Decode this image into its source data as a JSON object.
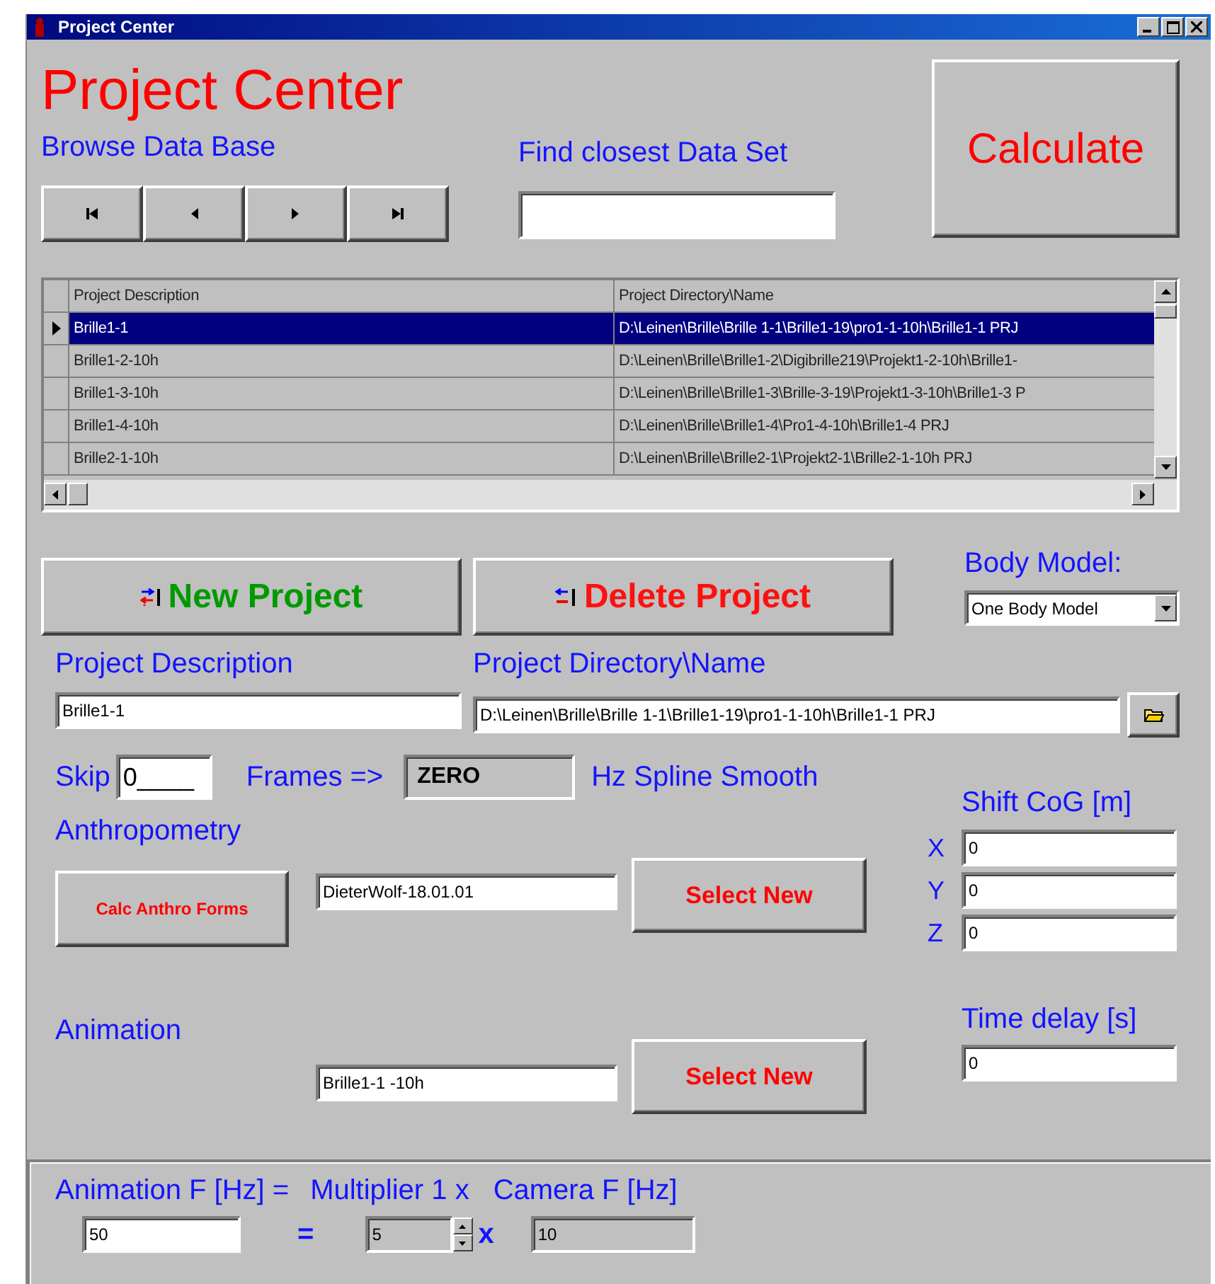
{
  "window": {
    "title": "Project Center"
  },
  "heading": "Project Center",
  "browse": {
    "label": "Browse Data Base",
    "buttons": [
      {
        "kind": "first"
      },
      {
        "kind": "prev"
      },
      {
        "kind": "next"
      },
      {
        "kind": "last"
      }
    ]
  },
  "find": {
    "label": "Find closest Data Set"
  },
  "calculate_button": "Calculate",
  "table": {
    "columns": [
      "Project Description",
      "Project Directory\\Name"
    ],
    "rows": [
      {
        "cells": [
          "Brille1-1",
          "D:\\Leinen\\Brille\\Brille 1-1\\Brille1-19\\pro1-1-10h\\Brille1-1 PRJ"
        ],
        "selected": true
      },
      {
        "cells": [
          "Brille1-2-10h",
          "D:\\Leinen\\Brille\\Brille1-2\\Digibrille219\\Projekt1-2-10h\\Brille1-"
        ],
        "selected": false
      },
      {
        "cells": [
          "Brille1-3-10h",
          "D:\\Leinen\\Brille\\Brille1-3\\Brille-3-19\\Projekt1-3-10h\\Brille1-3 P"
        ],
        "selected": false
      },
      {
        "cells": [
          "Brille1-4-10h",
          "D:\\Leinen\\Brille\\Brille1-4\\Pro1-4-10h\\Brille1-4 PRJ"
        ],
        "selected": false
      },
      {
        "cells": [
          "Brille2-1-10h",
          "D:\\Leinen\\Brille\\Brille2-1\\Projekt2-1\\Brille2-1-10h PRJ"
        ],
        "selected": false
      }
    ]
  },
  "actions": [
    {
      "kind": "new",
      "label": "New Project"
    },
    {
      "kind": "delete",
      "label": "Delete Project"
    }
  ],
  "body_model": {
    "label": "Body Model:",
    "value": "One Body Model"
  },
  "project_description": {
    "label": "Project Description",
    "value": "Brille1-1"
  },
  "project_directory": {
    "label": "Project Directory\\Name",
    "value": "D:\\Leinen\\Brille\\Brille 1-1\\Brille1-19\\pro1-1-10h\\Brille1-1 PRJ"
  },
  "skip": {
    "label": "Skip",
    "value": "0____",
    "frames_label": "Frames =>",
    "smoothing": "ZERO",
    "smoothing_label": "Hz Spline Smooth"
  },
  "anthropometry": {
    "label": "Anthropometry",
    "calc_button": "Calc Anthro Forms",
    "value": "DieterWolf-18.01.01",
    "select_button": "Select New"
  },
  "shift_cog": {
    "label": "Shift CoG [m]",
    "axes": [
      {
        "axis": "X",
        "value": "0"
      },
      {
        "axis": "Y",
        "value": "0"
      },
      {
        "axis": "Z",
        "value": "0"
      }
    ]
  },
  "animation": {
    "label": "Animation",
    "value": "Brille1-1 -10h",
    "select_button": "Select New"
  },
  "time_delay": {
    "label": "Time delay [s]",
    "value": "0"
  },
  "frequency": {
    "animation_label": "Animation F [Hz] =",
    "multiplier_label": "Multiplier 1 x",
    "camera_label": "Camera F [Hz]",
    "animation_value": "50",
    "equals": "=",
    "multiplier_value": "5",
    "times": "x",
    "camera_value": "10"
  }
}
